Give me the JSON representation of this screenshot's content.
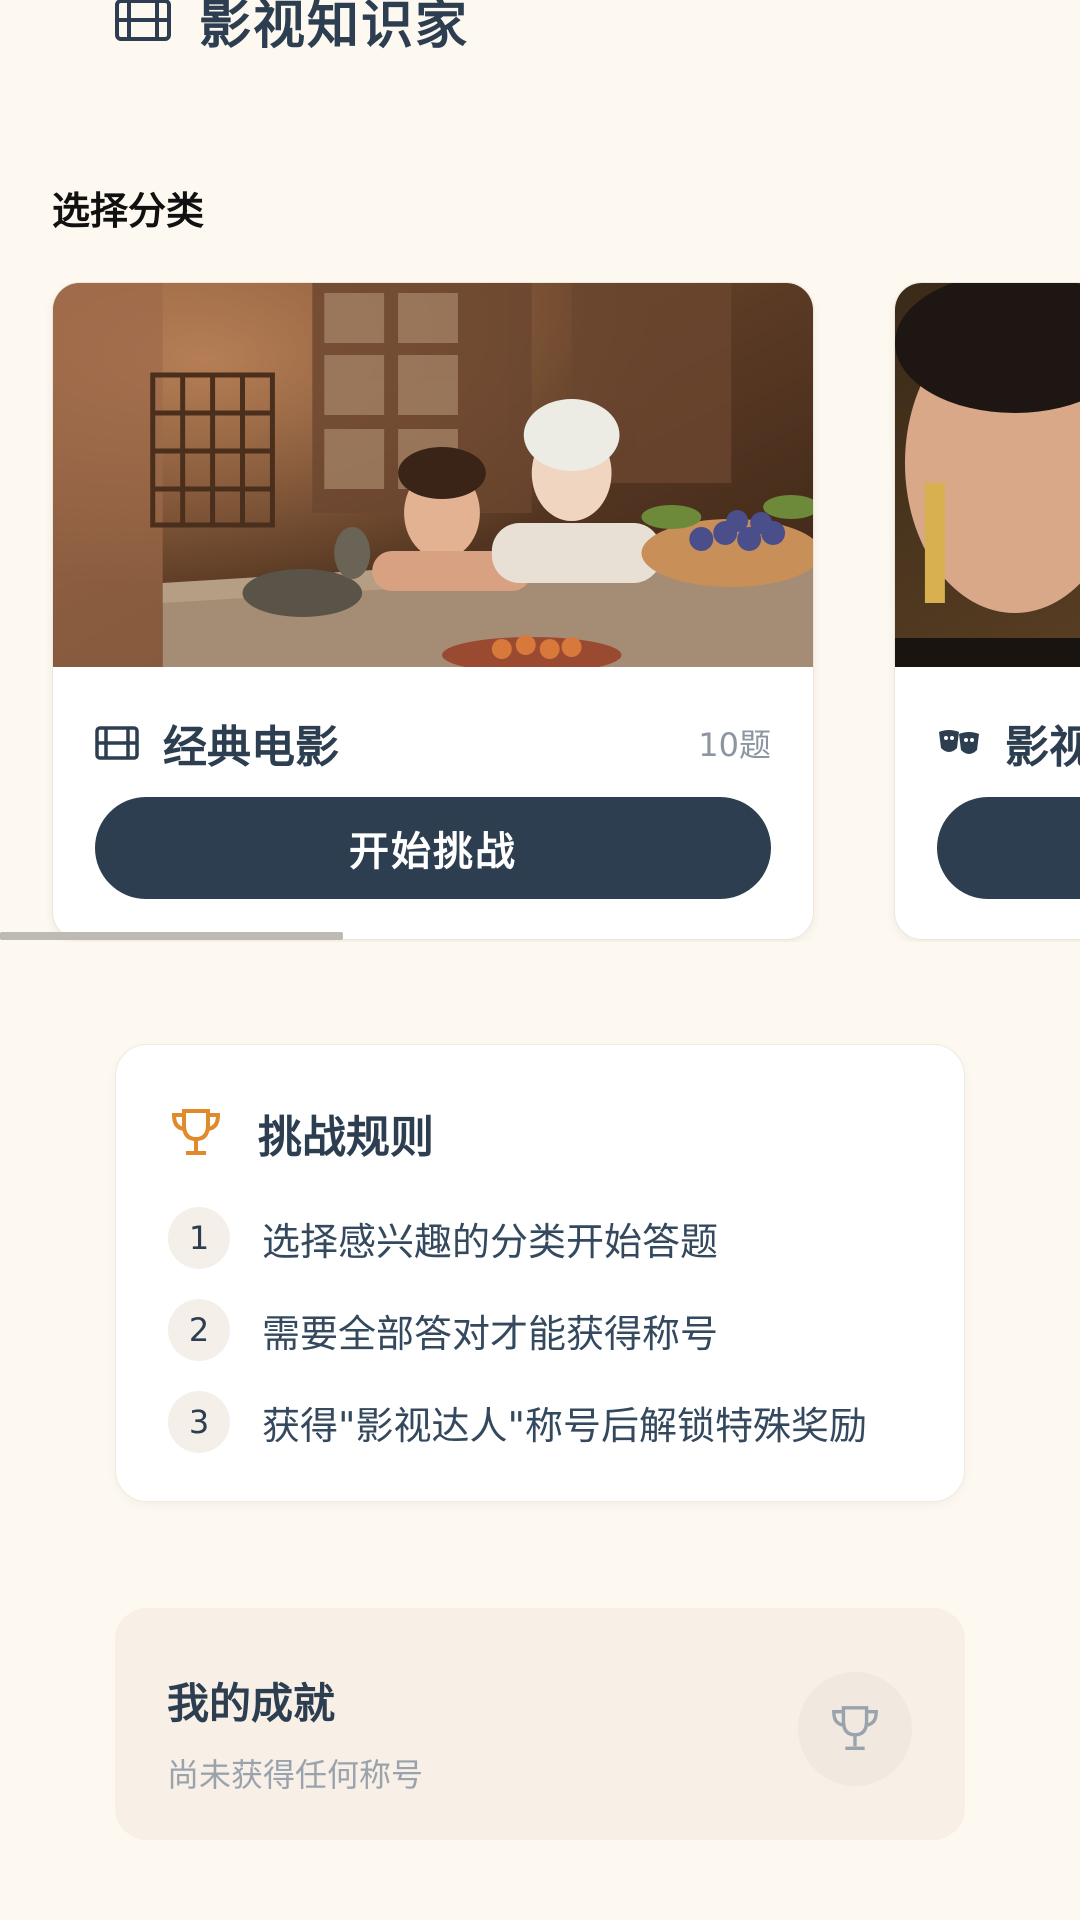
{
  "header": {
    "title": "影视知识家",
    "icon": "film-icon"
  },
  "categories_section": {
    "label": "选择分类"
  },
  "categories": [
    {
      "name": "经典电影",
      "count": "10题",
      "icon": "film-icon",
      "button_label": "开始挑战"
    },
    {
      "name": "影视",
      "icon": "theater-masks-icon"
    }
  ],
  "rules": {
    "title": "挑战规则",
    "icon": "trophy-icon",
    "items": [
      {
        "number": "1",
        "text": "选择感兴趣的分类开始答题"
      },
      {
        "number": "2",
        "text": "需要全部答对才能获得称号"
      },
      {
        "number": "3",
        "text": "获得\"影视达人\"称号后解锁特殊奖励"
      }
    ]
  },
  "achievements": {
    "title": "我的成就",
    "subtitle": "尚未获得任何称号",
    "icon": "trophy-icon"
  },
  "colors": {
    "background": "#fdf8f0",
    "primary": "#2c3e50",
    "accent": "#e08a2c",
    "muted": "#9aa3ad"
  }
}
